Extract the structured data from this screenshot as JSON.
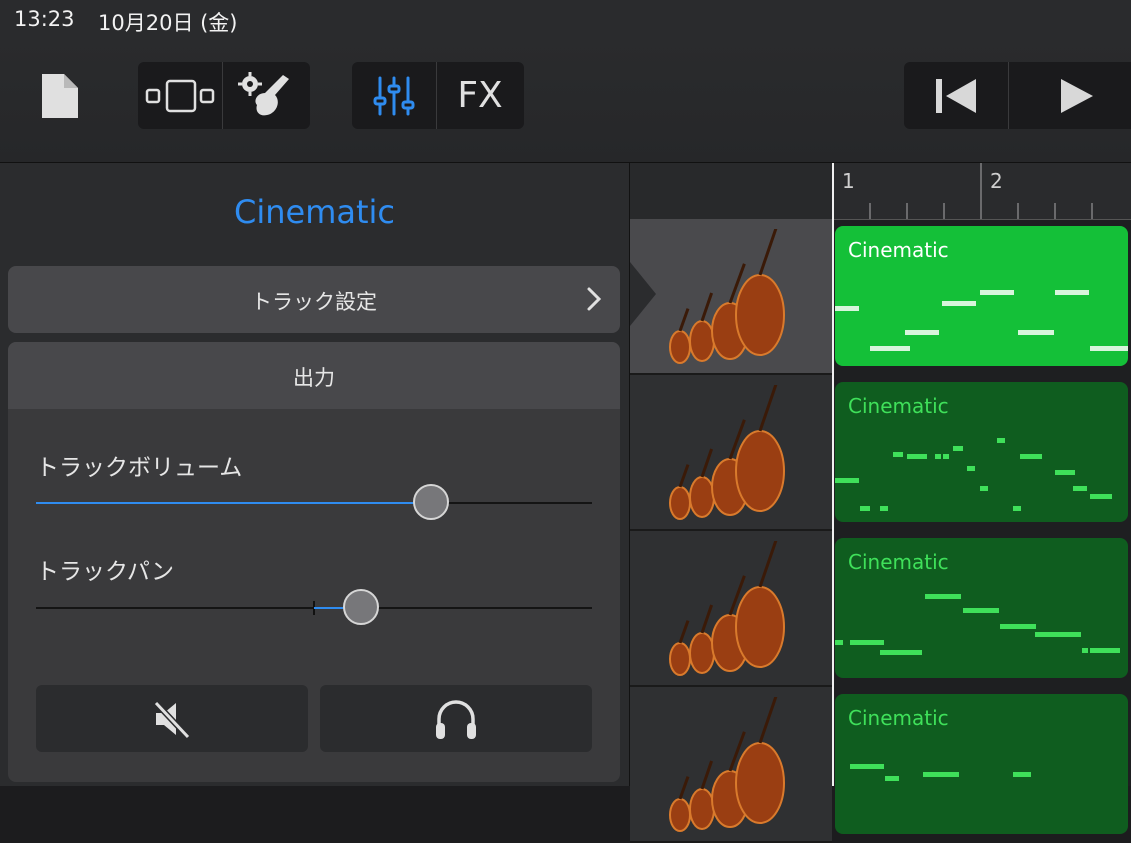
{
  "status_bar": {
    "time": "13:23",
    "date": "10月20日 (金)"
  },
  "toolbar": {
    "fx_label": "FX",
    "icons": [
      "document-icon",
      "track-view-icon",
      "instrument-settings-icon",
      "mixer-icon",
      "fx-button",
      "go-to-start-icon",
      "play-icon"
    ]
  },
  "panel": {
    "title": "Cinematic",
    "track_settings_label": "トラック設定",
    "output_label": "出力",
    "volume_label": "トラックボリューム",
    "volume_value": 0.71,
    "pan_label": "トラックパン",
    "pan_value": 0.17,
    "mute_icon": "speaker-mute-icon",
    "solo_icon": "headphones-icon"
  },
  "ruler": {
    "bar1": "1",
    "bar2": "2"
  },
  "regions": [
    {
      "name": "Cinematic",
      "selected": true
    },
    {
      "name": "Cinematic",
      "selected": false
    },
    {
      "name": "Cinematic",
      "selected": false
    },
    {
      "name": "Cinematic",
      "selected": false
    }
  ],
  "colors": {
    "accent": "#2f8cf0",
    "region_selected": "#14c038",
    "region_normal": "#0f5d1f",
    "region_text_normal": "#3fe05a"
  }
}
